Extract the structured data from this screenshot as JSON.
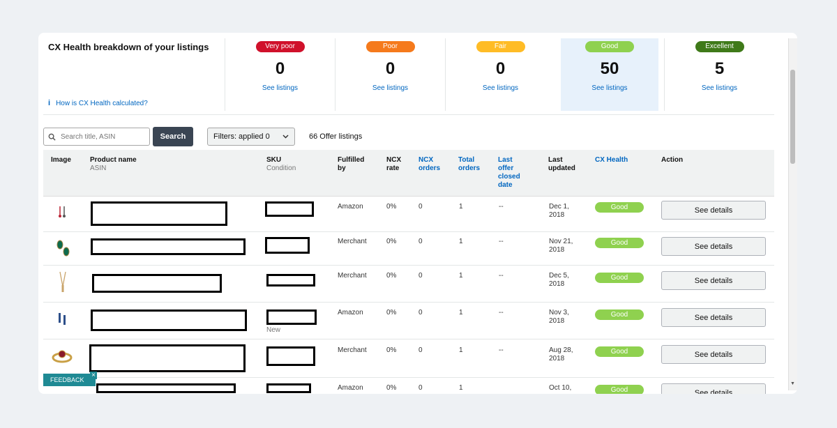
{
  "summary": {
    "title": "CX Health breakdown of your listings",
    "help_link": "How is CX Health calculated?",
    "info_icon": "i",
    "tiles": [
      {
        "label": "Very poor",
        "count": "0",
        "link": "See listings",
        "pill_color": "#d0112b",
        "text_color": "#ffffff"
      },
      {
        "label": "Poor",
        "count": "0",
        "link": "See listings",
        "pill_color": "#f57a1c",
        "text_color": "#ffffff"
      },
      {
        "label": "Fair",
        "count": "0",
        "link": "See listings",
        "pill_color": "#ffbc26",
        "text_color": "#ffffff"
      },
      {
        "label": "Good",
        "count": "50",
        "link": "See listings",
        "pill_color": "#8fd14f",
        "text_color": "#ffffff",
        "selected": true
      },
      {
        "label": "Excellent",
        "count": "5",
        "link": "See listings",
        "pill_color": "#3f7a19",
        "text_color": "#ffffff"
      }
    ]
  },
  "toolbar": {
    "search_placeholder": "Search title, ASIN",
    "search_button": "Search",
    "filters_label": "Filters: applied 0",
    "offer_count": "66 Offer listings"
  },
  "table": {
    "headers": {
      "image": "Image",
      "product_name": "Product name",
      "asin": "ASIN",
      "sku": "SKU",
      "condition": "Condition",
      "fulfilled_1": "Fulfilled",
      "fulfilled_2": "by",
      "ncx_rate_1": "NCX",
      "ncx_rate_2": "rate",
      "ncx_orders_1": "NCX",
      "ncx_orders_2": "orders",
      "total_orders_1": "Total",
      "total_orders_2": "orders",
      "last_offer_1": "Last",
      "last_offer_2": "offer",
      "last_offer_3": "closed",
      "last_offer_4": "date",
      "last_updated_1": "Last",
      "last_updated_2": "updated",
      "cx_health": "CX Health",
      "action": "Action"
    },
    "rows": [
      {
        "fulfilled": "Amazon",
        "ncx_rate": "0%",
        "ncx_orders": "0",
        "total_orders": "1",
        "last_offer": "--",
        "updated_1": "Dec 1,",
        "updated_2": "2018",
        "health": "Good",
        "action": "See details",
        "condition": ""
      },
      {
        "fulfilled": "Merchant",
        "ncx_rate": "0%",
        "ncx_orders": "0",
        "total_orders": "1",
        "last_offer": "--",
        "updated_1": "Nov 21,",
        "updated_2": "2018",
        "health": "Good",
        "action": "See details",
        "condition": ""
      },
      {
        "fulfilled": "Merchant",
        "ncx_rate": "0%",
        "ncx_orders": "0",
        "total_orders": "1",
        "last_offer": "--",
        "updated_1": "Dec 5,",
        "updated_2": "2018",
        "health": "Good",
        "action": "See details",
        "condition": ""
      },
      {
        "fulfilled": "Amazon",
        "ncx_rate": "0%",
        "ncx_orders": "0",
        "total_orders": "1",
        "last_offer": "--",
        "updated_1": "Nov 3,",
        "updated_2": "2018",
        "health": "Good",
        "action": "See details",
        "condition": "New"
      },
      {
        "fulfilled": "Merchant",
        "ncx_rate": "0%",
        "ncx_orders": "0",
        "total_orders": "1",
        "last_offer": "--",
        "updated_1": "Aug 28,",
        "updated_2": "2018",
        "health": "Good",
        "action": "See details",
        "condition": ""
      },
      {
        "fulfilled": "Amazon",
        "ncx_rate": "0%",
        "ncx_orders": "0",
        "total_orders": "1",
        "last_offer": "",
        "updated_1": "Oct 10,",
        "updated_2": "",
        "health": "Good",
        "action": "See details",
        "condition": ""
      }
    ]
  },
  "feedback": {
    "label": "FEEDBACK",
    "close": "×"
  },
  "icons": {
    "search": "search-icon",
    "chevron": "chevron-down-icon"
  }
}
